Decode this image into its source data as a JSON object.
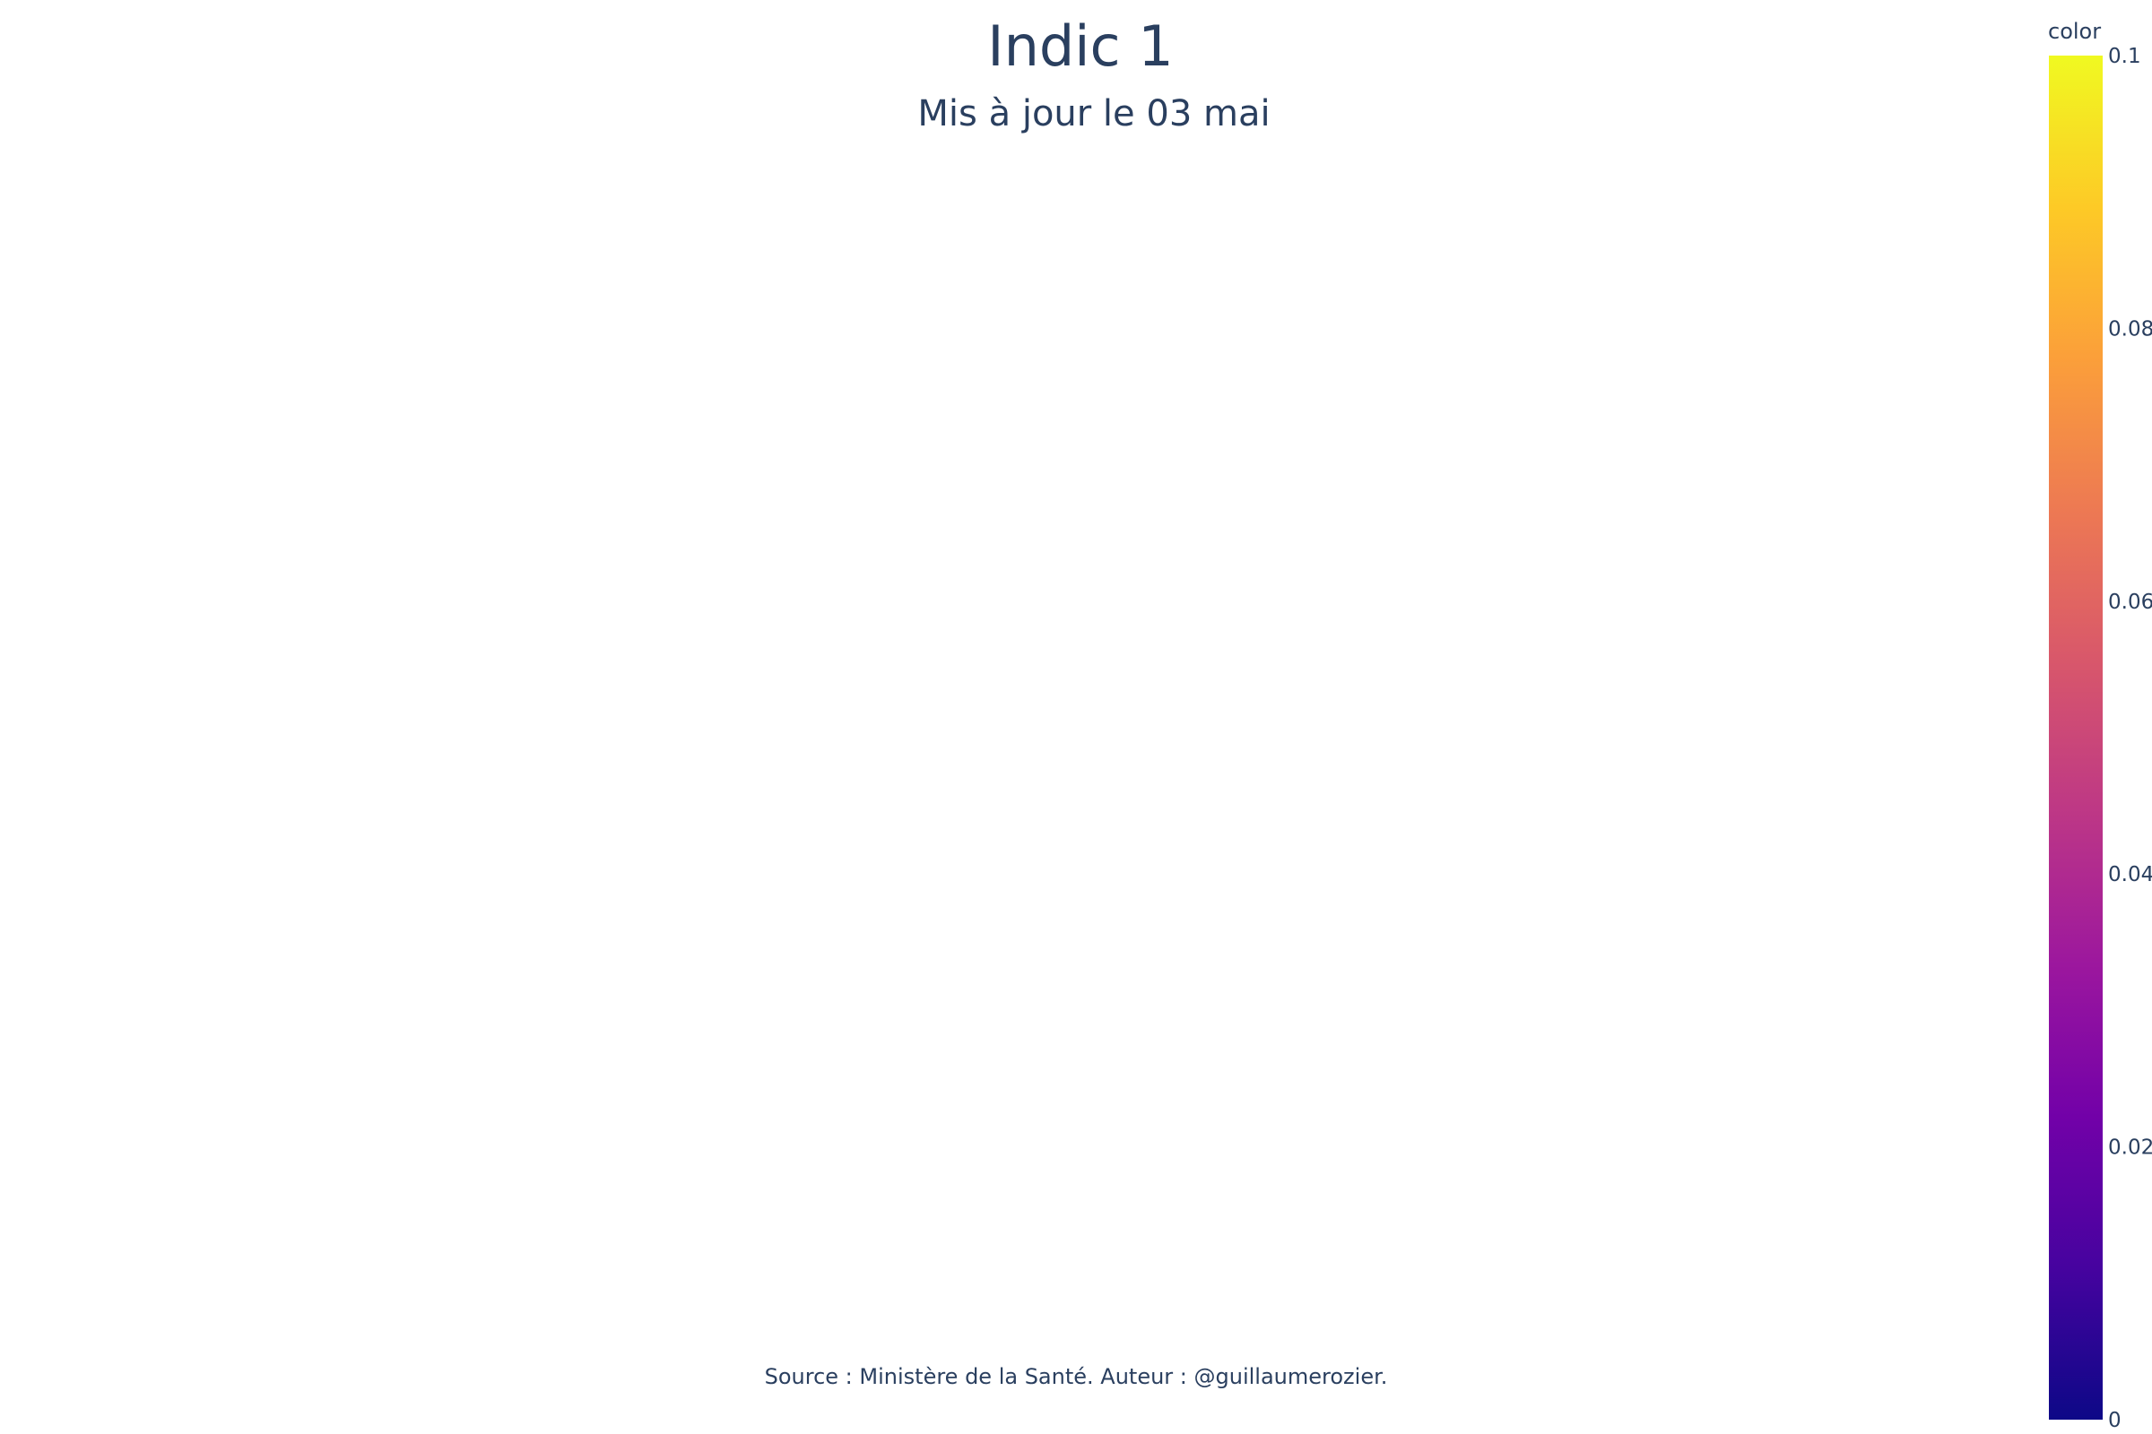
{
  "title": "Indic 1",
  "subtitle": "Mis à jour le 03 mai",
  "annotation": "Source : Ministère de la Santé. Auteur : @guillaumerozier.",
  "colors": {
    "text": "#2a3f5f",
    "background": "#ffffff"
  },
  "chart_data": {
    "type": "heatmap",
    "title": "Indic 1",
    "subtitle": "Mis à jour le 03 mai",
    "regions": [],
    "colorbar": {
      "title": "color",
      "range": [
        0,
        0.1
      ],
      "ticks": [
        {
          "value": 0,
          "label": "0"
        },
        {
          "value": 0.02,
          "label": "0.02"
        },
        {
          "value": 0.04,
          "label": "0.04"
        },
        {
          "value": 0.06,
          "label": "0.06"
        },
        {
          "value": 0.08,
          "label": "0.08"
        },
        {
          "value": 0.1,
          "label": "0.1"
        }
      ],
      "colorscale": [
        "#0d0887",
        "#46039f",
        "#7201a8",
        "#9c179e",
        "#bd3786",
        "#d8576b",
        "#ed7953",
        "#fb9f3a",
        "#fdca26",
        "#f0f921"
      ]
    }
  }
}
